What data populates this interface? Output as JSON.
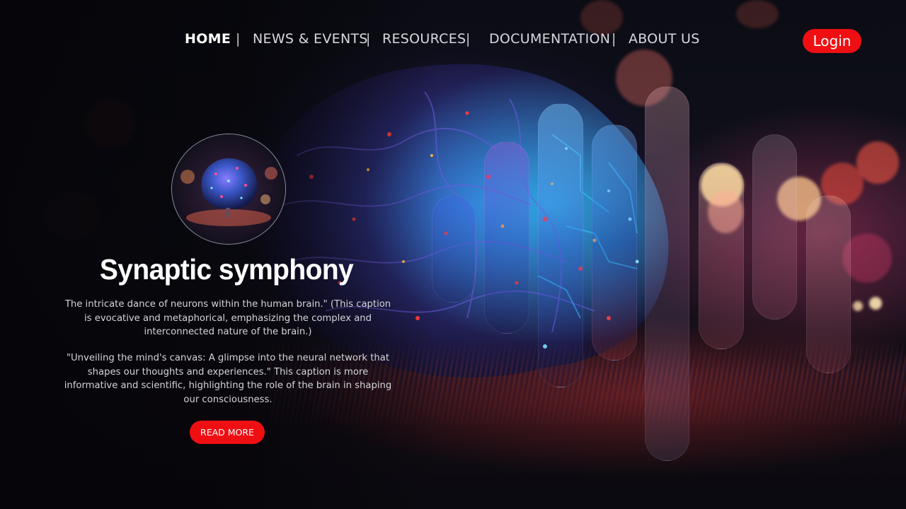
{
  "nav": {
    "items": [
      {
        "label": "HOME",
        "active": true
      },
      {
        "label": "NEWS & EVENTS",
        "active": false
      },
      {
        "label": "RESOURCES",
        "active": false
      },
      {
        "label": "DOCUMENTATION",
        "active": false
      },
      {
        "label": "ABOUT US",
        "active": false
      }
    ],
    "separator": "|",
    "login_label": "Login"
  },
  "hero": {
    "title": "Synaptic symphony",
    "paragraph_1": "The intricate dance of neurons within the human brain.\" (This caption is evocative and metaphorical, emphasizing the complex and interconnected nature of the brain.)",
    "paragraph_2": "\"Unveiling the mind's canvas: A glimpse into the neural network that shapes our thoughts and experiences.\" This caption is more informative and scientific, highlighting the role of the brain in shaping our consciousness.",
    "button_label": "READ MORE"
  },
  "colors": {
    "accent": "#ef0f13",
    "background": "#07080d",
    "text": "#d4d4d8"
  },
  "images": {
    "background": "circuit-brain-illustration",
    "thumbnail": "glowing-brain-thumbnail"
  }
}
